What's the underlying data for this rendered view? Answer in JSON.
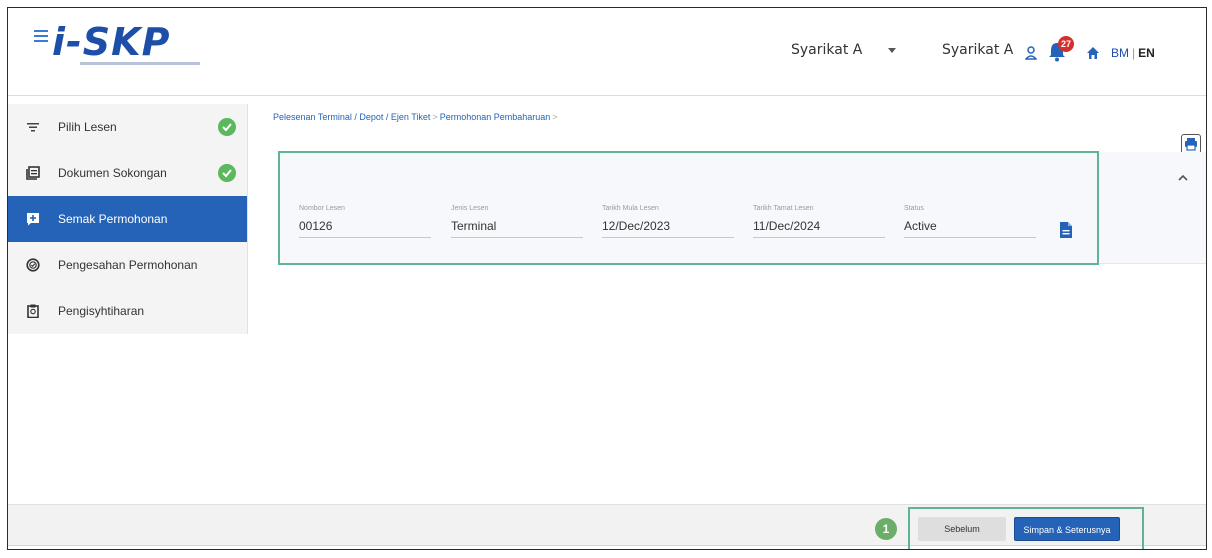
{
  "header": {
    "logo_prefix": "i-S",
    "logo_suffix": "KP",
    "company_select": "Syarikat A",
    "company_name": "Syarikat A",
    "notification_count": "27",
    "lang_bm": "BM",
    "lang_sep": "|",
    "lang_en": "EN"
  },
  "sidebar": {
    "items": [
      {
        "label": "Pilih Lesen",
        "icon": "filter-icon",
        "done": true
      },
      {
        "label": "Dokumen Sokongan",
        "icon": "library-icon",
        "done": true
      },
      {
        "label": "Semak Permohonan",
        "icon": "add-box-icon",
        "active": true
      },
      {
        "label": "Pengesahan Permohonan",
        "icon": "check-circle-outline-icon"
      },
      {
        "label": "Pengisyhtiharan",
        "icon": "clipboard-icon"
      }
    ]
  },
  "breadcrumb": {
    "part1": "Pelesenan Terminal / Depot / Ejen Tiket",
    "sep": ">",
    "part2": "Permohonan Pembaharuan"
  },
  "license": {
    "nombor_label": "Nombor Lesen",
    "nombor_value": "00126",
    "jenis_label": "Jenis Lesen",
    "jenis_value": "Terminal",
    "mula_label": "Tarikh Mula Lesen",
    "mula_value": "12/Dec/2023",
    "tamat_label": "Tarikh Tamat Lesen",
    "tamat_value": "11/Dec/2024",
    "status_label": "Status",
    "status_value": "Active"
  },
  "footer": {
    "step": "1",
    "prev_label": "Sebelum",
    "next_label": "Simpan & Seterusnya"
  },
  "colors": {
    "accent": "#2563b8",
    "highlight": "#5fb593",
    "check": "#5cb85c",
    "badge": "#d32f2f"
  }
}
